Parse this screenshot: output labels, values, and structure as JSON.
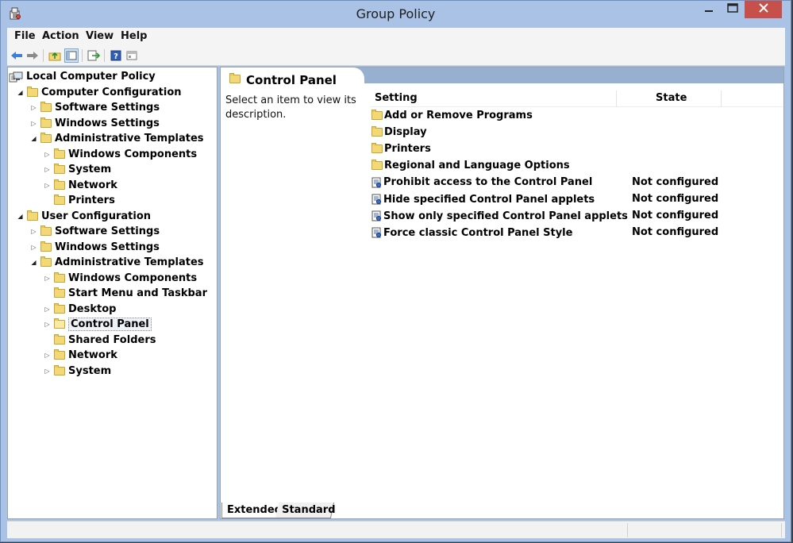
{
  "window": {
    "title": "Group Policy",
    "colors": {
      "titlebar": "#a9c2e6",
      "close": "#c7504b",
      "pane_header": "#97b0d0"
    }
  },
  "menu": [
    "File",
    "Action",
    "View",
    "Help"
  ],
  "toolbar": [
    "back-icon",
    "forward-icon",
    "up-folder-icon",
    "show-hide-tree-icon",
    "export-list-icon",
    "help-icon",
    "properties-view-icon"
  ],
  "tree": [
    {
      "label": "Local Computer Policy",
      "level": 0,
      "icon": "computer-policy-icon",
      "toggle": "none"
    },
    {
      "label": "Computer Configuration",
      "level": 1,
      "icon": "folder-icon",
      "toggle": "expanded"
    },
    {
      "label": "Software Settings",
      "level": 2,
      "icon": "folder-icon",
      "toggle": "collapsed"
    },
    {
      "label": "Windows Settings",
      "level": 2,
      "icon": "folder-icon",
      "toggle": "collapsed"
    },
    {
      "label": "Administrative Templates",
      "level": 2,
      "icon": "folder-icon",
      "toggle": "expanded"
    },
    {
      "label": "Windows Components",
      "level": 3,
      "icon": "folder-icon",
      "toggle": "collapsed"
    },
    {
      "label": "System",
      "level": 3,
      "icon": "folder-icon",
      "toggle": "collapsed"
    },
    {
      "label": "Network",
      "level": 3,
      "icon": "folder-icon",
      "toggle": "collapsed"
    },
    {
      "label": "Printers",
      "level": 3,
      "icon": "folder-icon",
      "toggle": "none"
    },
    {
      "label": "User Configuration",
      "level": 1,
      "icon": "folder-icon",
      "toggle": "expanded"
    },
    {
      "label": "Software Settings",
      "level": 2,
      "icon": "folder-icon",
      "toggle": "collapsed"
    },
    {
      "label": "Windows Settings",
      "level": 2,
      "icon": "folder-icon",
      "toggle": "collapsed"
    },
    {
      "label": "Administrative Templates",
      "level": 2,
      "icon": "folder-icon",
      "toggle": "expanded"
    },
    {
      "label": "Windows Components",
      "level": 3,
      "icon": "folder-icon",
      "toggle": "collapsed"
    },
    {
      "label": "Start Menu and Taskbar",
      "level": 3,
      "icon": "folder-icon",
      "toggle": "none"
    },
    {
      "label": "Desktop",
      "level": 3,
      "icon": "folder-icon",
      "toggle": "collapsed"
    },
    {
      "label": "Control Panel",
      "level": 3,
      "icon": "open-folder-icon",
      "toggle": "collapsed",
      "selected": true
    },
    {
      "label": "Shared Folders",
      "level": 3,
      "icon": "folder-icon",
      "toggle": "none"
    },
    {
      "label": "Network",
      "level": 3,
      "icon": "folder-icon",
      "toggle": "collapsed"
    },
    {
      "label": "System",
      "level": 3,
      "icon": "folder-icon",
      "toggle": "collapsed"
    }
  ],
  "details": {
    "title": "Control Panel",
    "description": "Select an item to view its description.",
    "columns": {
      "setting": "Setting",
      "state": "State"
    },
    "rows": [
      {
        "name": "Add or Remove Programs",
        "type": "folder",
        "state": ""
      },
      {
        "name": "Display",
        "type": "folder",
        "state": ""
      },
      {
        "name": "Printers",
        "type": "folder",
        "state": ""
      },
      {
        "name": "Regional and Language Options",
        "type": "folder",
        "state": ""
      },
      {
        "name": "Prohibit access to the Control Panel",
        "type": "policy",
        "state": "Not configured"
      },
      {
        "name": "Hide specified Control Panel applets",
        "type": "policy",
        "state": "Not configured"
      },
      {
        "name": "Show only specified Control Panel applets",
        "type": "policy",
        "state": "Not configured"
      },
      {
        "name": "Force classic Control Panel Style",
        "type": "policy",
        "state": "Not configured"
      }
    ]
  },
  "tabs": [
    {
      "label": "Extended",
      "active": true
    },
    {
      "label": "Standard",
      "active": false
    }
  ]
}
